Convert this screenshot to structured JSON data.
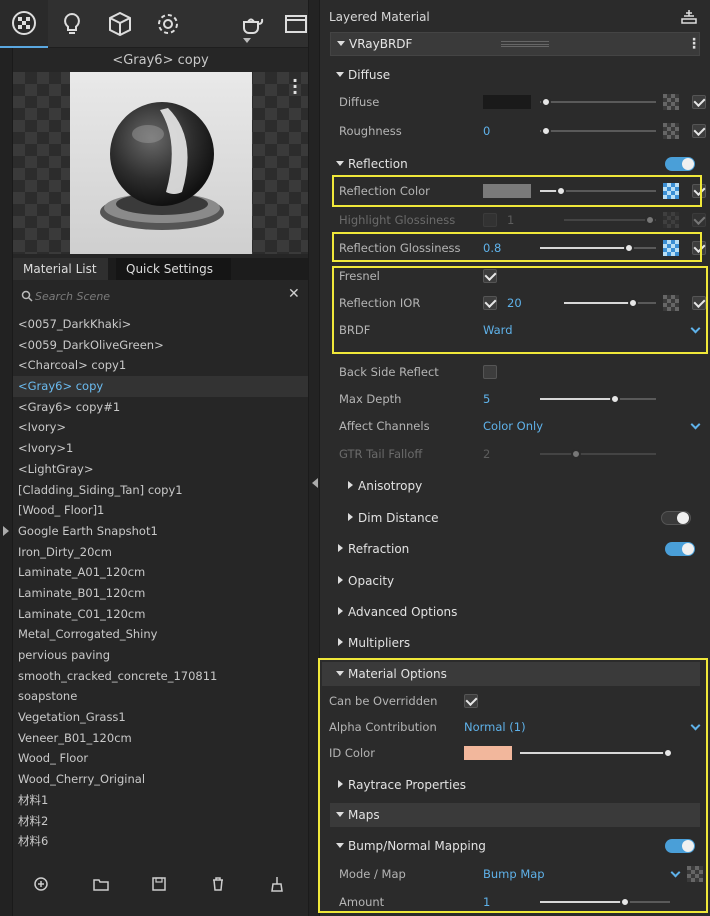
{
  "toolbar": {
    "tabs": [
      "materials-icon",
      "lightbulb-icon",
      "cube-icon",
      "gear-icon",
      "teapot-icon",
      "window-icon"
    ]
  },
  "preview": {
    "title": "<Gray6> copy"
  },
  "material_tabs": {
    "list": "Material List",
    "quick": "Quick Settings"
  },
  "search": {
    "placeholder": "Search Scene"
  },
  "materials": [
    "<0057_DarkKhaki>",
    "<0059_DarkOliveGreen>",
    "<Charcoal> copy1",
    "<Gray6> copy",
    "<Gray6> copy#1",
    "<Ivory>",
    "<Ivory>1",
    "<LightGray>",
    "[Cladding_Siding_Tan] copy1",
    "[Wood_ Floor]1",
    "Google Earth Snapshot1",
    "Iron_Dirty_20cm",
    "Laminate_A01_120cm",
    "Laminate_B01_120cm",
    "Laminate_C01_120cm",
    "Metal_Corrogated_Shiny",
    "pervious paving",
    "smooth_cracked_concrete_170811",
    "soapstone",
    "Vegetation_Grass1",
    "Veneer_B01_120cm",
    "Wood_ Floor",
    "Wood_Cherry_Original",
    "材料1",
    "材料2",
    "材料6"
  ],
  "selected_material": "<Gray6> copy",
  "bottom_icons": [
    "add-material-icon",
    "open-folder-icon",
    "save-icon",
    "trash-icon",
    "purge-icon"
  ],
  "editor": {
    "title": "Layered Material",
    "brdf": "VRayBRDF",
    "diffuse": {
      "header": "Diffuse",
      "diffuse_label": "Diffuse",
      "diffuse_color": "#1a1a1a",
      "roughness_label": "Roughness",
      "roughness_value": "0"
    },
    "reflection": {
      "header": "Reflection",
      "enabled": true,
      "color_label": "Reflection Color",
      "color": "#7a7a7a",
      "color_level": 0.1,
      "highlight_label": "Highlight Glossiness",
      "highlight_value": "1",
      "glossiness_label": "Reflection Glossiness",
      "glossiness_value": "0.8",
      "fresnel_label": "Fresnel",
      "ior_label": "Reflection IOR",
      "ior_value": "20",
      "brdf_label": "BRDF",
      "brdf_value": "Ward",
      "backside_label": "Back Side Reflect",
      "maxdepth_label": "Max Depth",
      "maxdepth_value": "5",
      "affect_label": "Affect Channels",
      "affect_value": "Color Only",
      "gtr_label": "GTR Tail Falloff",
      "gtr_value": "2",
      "anisotropy": "Anisotropy",
      "dim_distance": "Dim Distance"
    },
    "refraction": "Refraction",
    "opacity": "Opacity",
    "advanced": "Advanced Options",
    "multipliers": "Multipliers",
    "material_options": {
      "header": "Material Options",
      "overridden_label": "Can be Overridden",
      "alpha_label": "Alpha Contribution",
      "alpha_value": "Normal (1)",
      "idcolor_label": "ID Color",
      "idcolor": "#f2b79c",
      "raytrace": "Raytrace Properties"
    },
    "maps": {
      "header": "Maps",
      "bump_header": "Bump/Normal Mapping",
      "mode_label": "Mode / Map",
      "mode_value": "Bump Map",
      "amount_label": "Amount",
      "amount_value": "1"
    }
  },
  "colors": {
    "accent": "#5fb2ea",
    "highlight": "#f0e83a",
    "toggle_on": "#4a9fd8"
  }
}
